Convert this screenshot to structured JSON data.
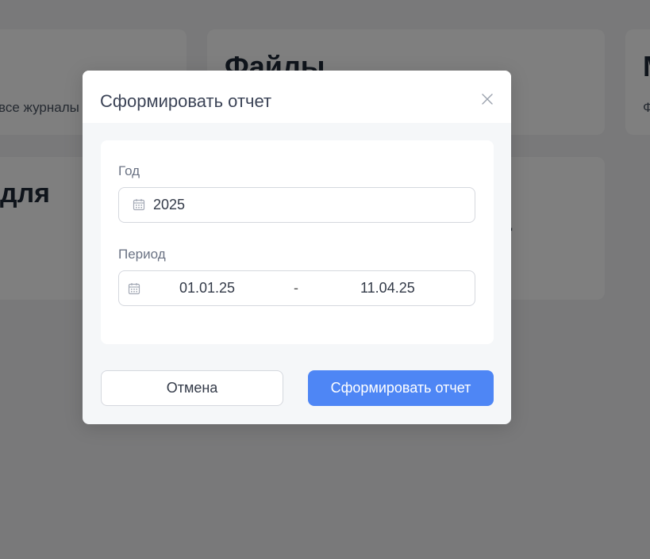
{
  "background": {
    "card_a_sub": "все журналы",
    "card_b_title": "Файлы",
    "card_c_title": "М",
    "card_c_sub": "Ф",
    "card_d_title": "для",
    "card_e_sub": "\""
  },
  "modal": {
    "title": "Сформировать отчет",
    "close_icon": "close-icon",
    "year_label": "Год",
    "year_value": "2025",
    "period_label": "Период",
    "period_from": "01.01.25",
    "period_separator": "-",
    "period_to": "11.04.25",
    "cancel_label": "Отмена",
    "submit_label": "Сформировать отчет"
  },
  "colors": {
    "primary": "#4e86f5",
    "overlay": "rgba(0,0,0,0.5)"
  }
}
